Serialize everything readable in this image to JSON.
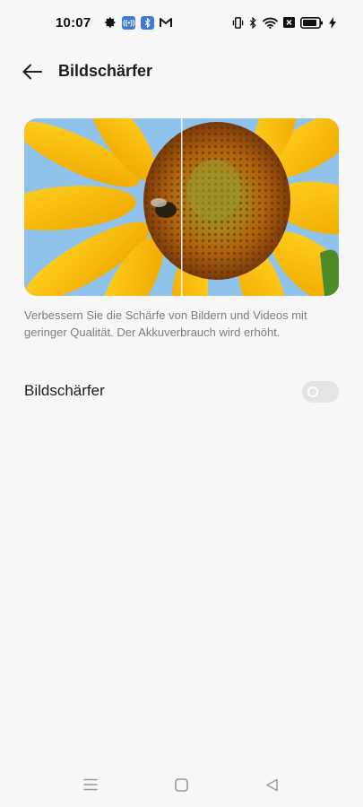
{
  "status_bar": {
    "time": "10:07",
    "left_icons": [
      "gear-icon",
      "hotspot-icon",
      "bluetooth-badge-icon",
      "gmail-icon"
    ],
    "right_icons": [
      "vibrate-icon",
      "bluetooth-icon",
      "wifi-icon",
      "sim-off-icon",
      "battery-icon",
      "charging-icon"
    ]
  },
  "header": {
    "title": "Bildschärfer",
    "back_icon": "arrow-left-icon"
  },
  "preview": {
    "description": "Verbessern Sie die Schärfe von Bildern und Videos mit geringer Qualität. Der Akkuverbrauch wird erhöht."
  },
  "setting": {
    "label": "Bildschärfer",
    "enabled": false
  },
  "nav_bar": {
    "icons": [
      "menu-icon",
      "home-icon",
      "back-triangle-icon"
    ]
  },
  "colors": {
    "background": "#f7f7f7",
    "accent_badge": "#3f7ad8",
    "toggle_off": "#e4e4e4",
    "description_text": "#7d7d7d"
  }
}
